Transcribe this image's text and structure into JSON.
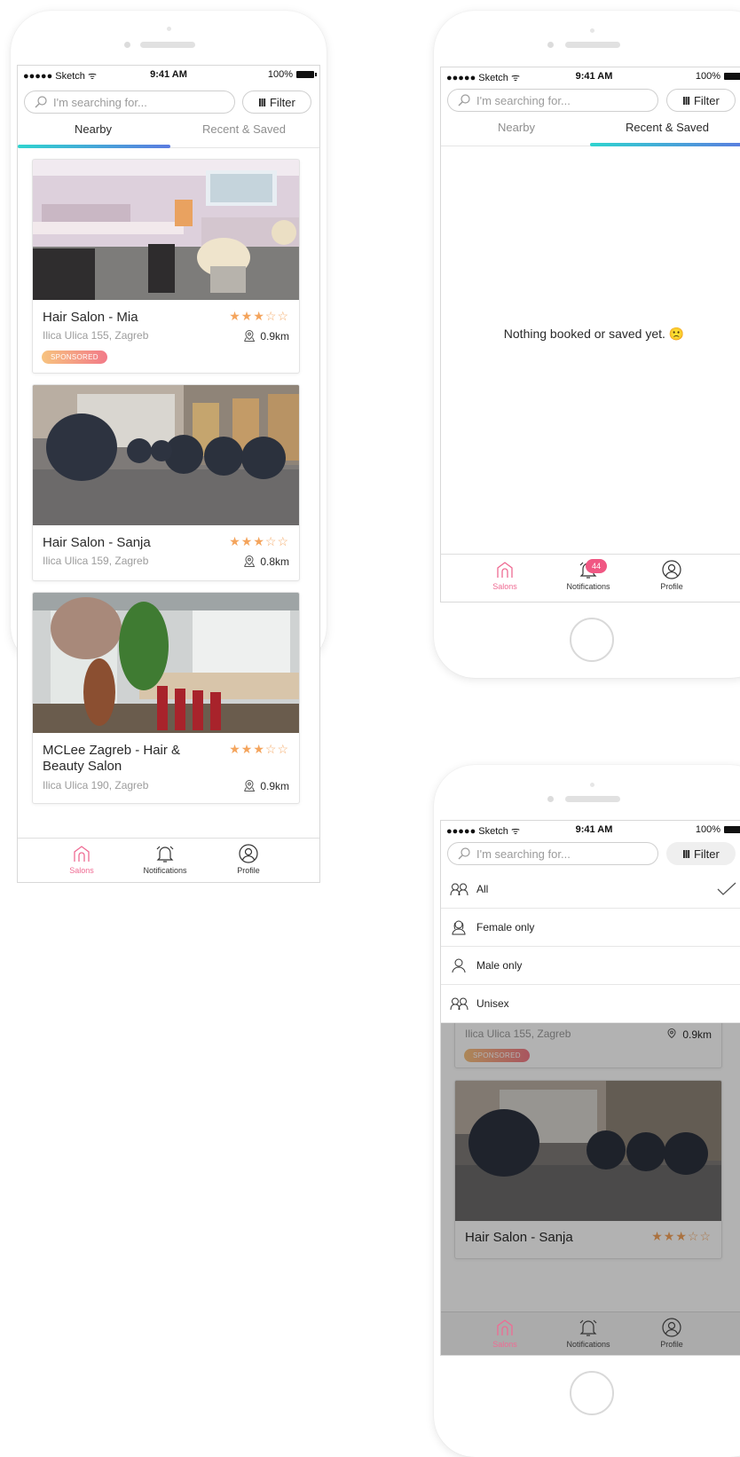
{
  "status": {
    "carrier": "●●●●● Sketch",
    "time": "9:41 AM",
    "battery": "100%"
  },
  "search": {
    "placeholder": "I'm searching for...",
    "filter_label": "Filter"
  },
  "tabs": {
    "nearby": "Nearby",
    "recent": "Recent & Saved"
  },
  "salons": [
    {
      "name": "Hair Salon - Mia",
      "address": "Ilica Ulica 155, Zagreb",
      "rating": 3,
      "distance": "0.9km",
      "badge": "SPONSORED"
    },
    {
      "name": "Hair Salon - Sanja",
      "address": "Ilica Ulica 159, Zagreb",
      "rating": 3,
      "distance": "0.8km"
    },
    {
      "name": "MCLee Zagreb - Hair & Beauty Salon",
      "address": "Ilica Ulica 190, Zagreb",
      "rating": 3,
      "distance": "0.9km"
    }
  ],
  "nav": {
    "salons": "Salons",
    "notifications": "Notifications",
    "profile": "Profile",
    "notification_count": "44"
  },
  "empty_state": "Nothing booked or saved yet. 🙁",
  "filter_menu": [
    {
      "label": "All",
      "icon": "unisex-icon",
      "selected": true
    },
    {
      "label": "Female only",
      "icon": "female-icon",
      "selected": false
    },
    {
      "label": "Male only",
      "icon": "male-icon",
      "selected": false
    },
    {
      "label": "Unisex",
      "icon": "unisex-icon",
      "selected": false
    }
  ],
  "colors": {
    "accent_pink": "#ef6b93",
    "star": "#f4a45c",
    "tab_gradient_start": "#2fd4cf",
    "tab_gradient_end": "#5b7be0"
  }
}
